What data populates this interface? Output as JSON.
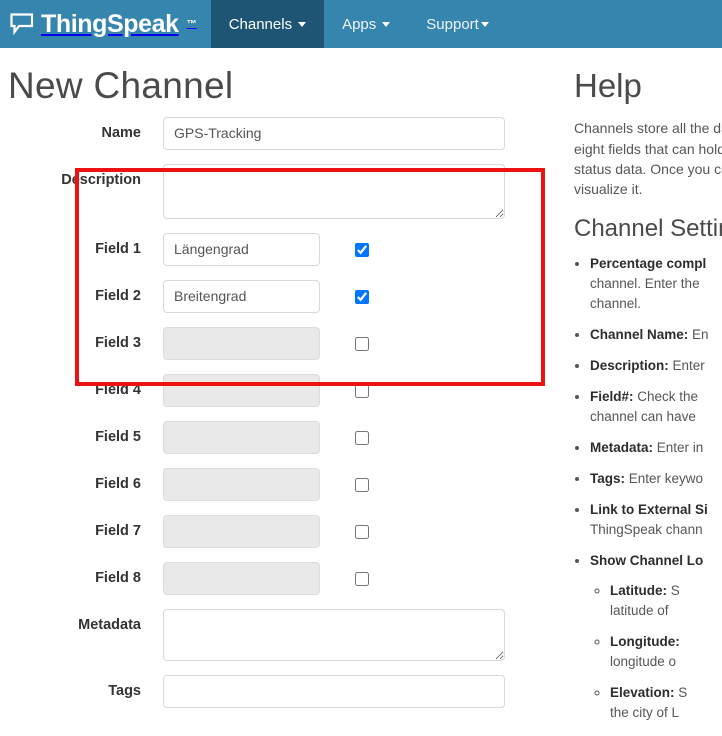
{
  "navbar": {
    "brand_name": "ThingSpeak",
    "brand_tm": "™",
    "brand_icon": "speech-bubble-icon",
    "items": [
      {
        "label": "Channels",
        "has_caret": true,
        "active": true
      },
      {
        "label": "Apps",
        "has_caret": true,
        "active": false
      },
      {
        "label": "Support",
        "has_caret": true,
        "active": false
      }
    ],
    "bg_color": "#3585ae",
    "active_bg_color": "#1f5574"
  },
  "page": {
    "title": "New Channel"
  },
  "highlight": {
    "color": "#ee1111"
  },
  "form": {
    "rows": [
      {
        "label": "Name",
        "type": "input",
        "value": "GPS-Tracking",
        "disabled": false,
        "checkbox": false,
        "checked": false
      },
      {
        "label": "Description",
        "type": "textarea",
        "value": "",
        "disabled": false,
        "checkbox": false,
        "checked": false
      },
      {
        "label": "Field 1",
        "type": "input",
        "value": "Längengrad",
        "disabled": false,
        "checkbox": true,
        "checked": true
      },
      {
        "label": "Field 2",
        "type": "input",
        "value": "Breitengrad",
        "disabled": false,
        "checkbox": true,
        "checked": true
      },
      {
        "label": "Field 3",
        "type": "input",
        "value": "",
        "disabled": true,
        "checkbox": true,
        "checked": false
      },
      {
        "label": "Field 4",
        "type": "input",
        "value": "",
        "disabled": true,
        "checkbox": true,
        "checked": false
      },
      {
        "label": "Field 5",
        "type": "input",
        "value": "",
        "disabled": true,
        "checkbox": true,
        "checked": false
      },
      {
        "label": "Field 6",
        "type": "input",
        "value": "",
        "disabled": true,
        "checkbox": true,
        "checked": false
      },
      {
        "label": "Field 7",
        "type": "input",
        "value": "",
        "disabled": true,
        "checkbox": true,
        "checked": false
      },
      {
        "label": "Field 8",
        "type": "input",
        "value": "",
        "disabled": true,
        "checkbox": true,
        "checked": false
      },
      {
        "label": "Metadata",
        "type": "textarea",
        "value": "",
        "disabled": false,
        "checkbox": false,
        "checked": false
      },
      {
        "label": "Tags",
        "type": "input",
        "value": "",
        "disabled": false,
        "checkbox": false,
        "checked": false
      }
    ]
  },
  "help": {
    "title": "Help",
    "intro": "Channels store all the da\neight fields that can hold\nstatus data. Once you co\nvisualize it.",
    "section_title": "Channel Settin",
    "items": [
      {
        "term": "Percentage compl",
        "rest": "\nchannel. Enter the\nchannel."
      },
      {
        "term": "Channel Name:",
        "rest": " En"
      },
      {
        "term": "Description:",
        "rest": " Enter"
      },
      {
        "term": "Field#:",
        "rest": " Check the\nchannel can have"
      },
      {
        "term": "Metadata:",
        "rest": " Enter in"
      },
      {
        "term": "Tags:",
        "rest": " Enter keywo"
      },
      {
        "term": "Link to External Si",
        "rest": "\nThingSpeak chann"
      },
      {
        "term": "Show Channel Lo",
        "rest": "",
        "sub": [
          {
            "term": "Latitude:",
            "rest": " S\nlatitude of"
          },
          {
            "term": "Longitude:",
            "rest": "\nlongitude o"
          },
          {
            "term": "Elevation:",
            "rest": " S\nthe city of L"
          }
        ]
      }
    ]
  }
}
